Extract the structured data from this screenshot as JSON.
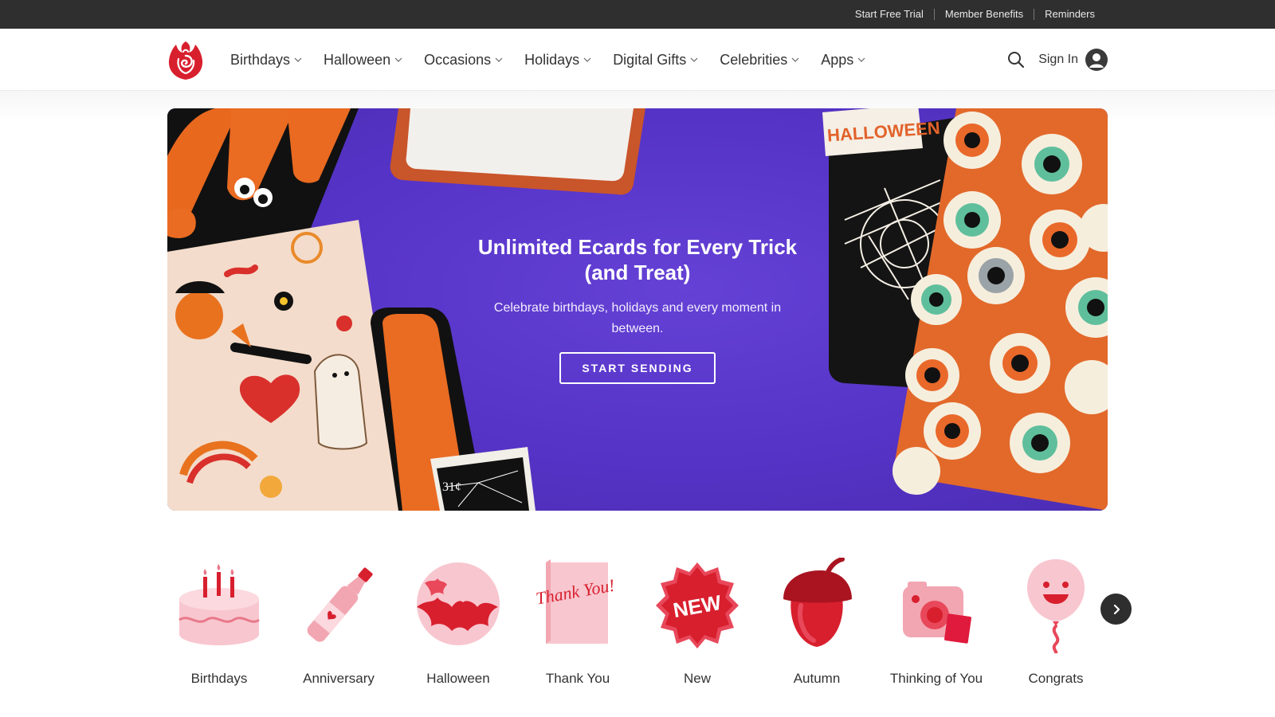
{
  "topbar": {
    "links": [
      "Start Free Trial",
      "Member Benefits",
      "Reminders"
    ]
  },
  "nav": {
    "items": [
      "Birthdays",
      "Halloween",
      "Occasions",
      "Holidays",
      "Digital Gifts",
      "Celebrities",
      "Apps"
    ],
    "signin_label": "Sign In"
  },
  "hero": {
    "title": "Unlimited Ecards for Every Trick (and Treat)",
    "subtitle": "Celebrate birthdays, holidays and every moment in between.",
    "cta": "START SENDING",
    "stamp_halloween": "HALLOWEEN",
    "stamp_price": "31¢"
  },
  "categories": [
    "Birthdays",
    "Anniversary",
    "Halloween",
    "Thank You",
    "New",
    "Autumn",
    "Thinking of You",
    "Congrats"
  ],
  "category_art": {
    "thank_you": "Thank You!",
    "new_badge": "NEW"
  },
  "colors": {
    "topbar_bg": "#2f2f2f",
    "hero_purple": "#5533c6",
    "brand_red": "#d81f2e",
    "icon_pink": "#f8c6cf"
  },
  "icons": [
    "rose-logo",
    "chevron-down-icon",
    "search-icon",
    "user-icon",
    "chevron-right-icon"
  ]
}
